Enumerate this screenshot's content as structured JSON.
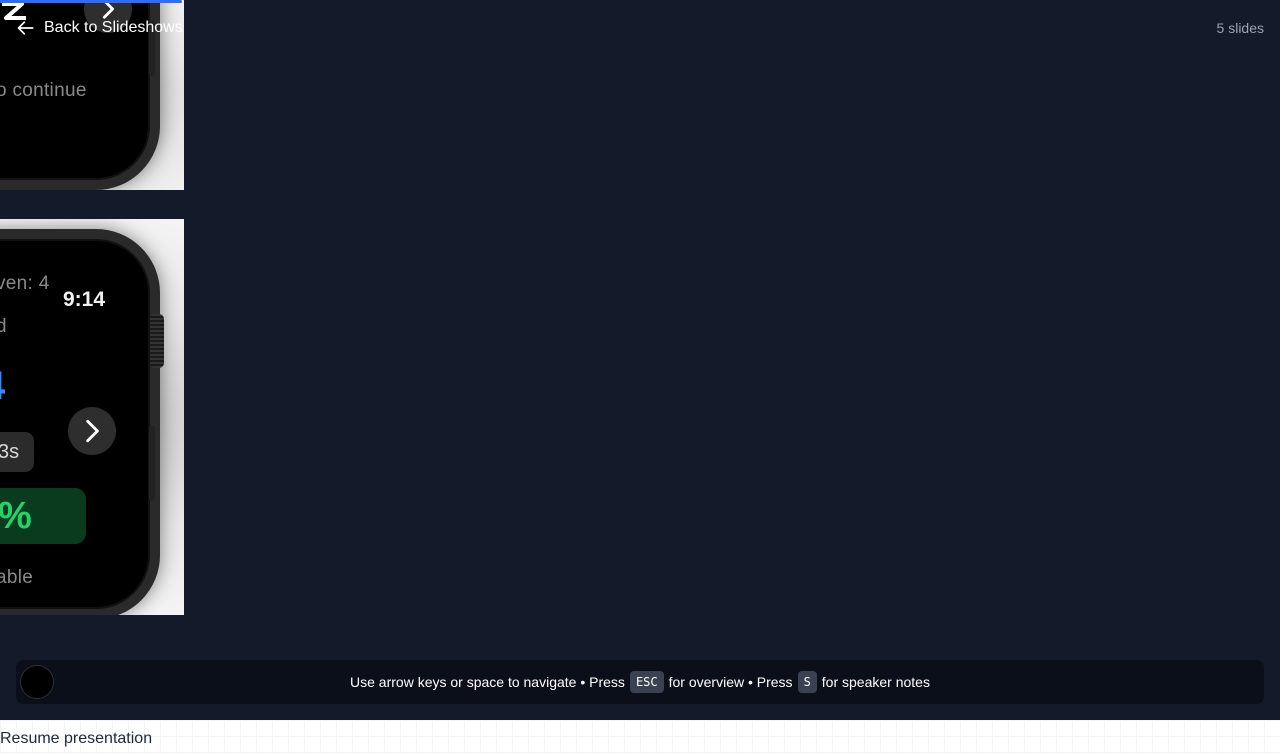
{
  "header": {
    "back_label": "Back to Slideshows",
    "slide_count": "5 slides"
  },
  "slides": [
    {
      "status_text": "o continue"
    },
    {
      "top_text": "ven: 4",
      "time": "9:14",
      "label_d": "d",
      "blue_value": "4",
      "pill_value": "3s",
      "big_value": "%",
      "bottom_text": "able"
    }
  ],
  "help": {
    "part1": "Use arrow keys or space to navigate • Press",
    "key_esc": "ESC",
    "part2": "for overview • Press",
    "key_s": "S",
    "part3": "for speaker notes"
  },
  "resume_label": "Resume presentation",
  "colors": {
    "background": "#131a2a",
    "accent": "#2f6bff",
    "green": "#22d36b"
  },
  "icons": {
    "back": "arrow-left-icon",
    "next": "chevron-right-icon"
  }
}
